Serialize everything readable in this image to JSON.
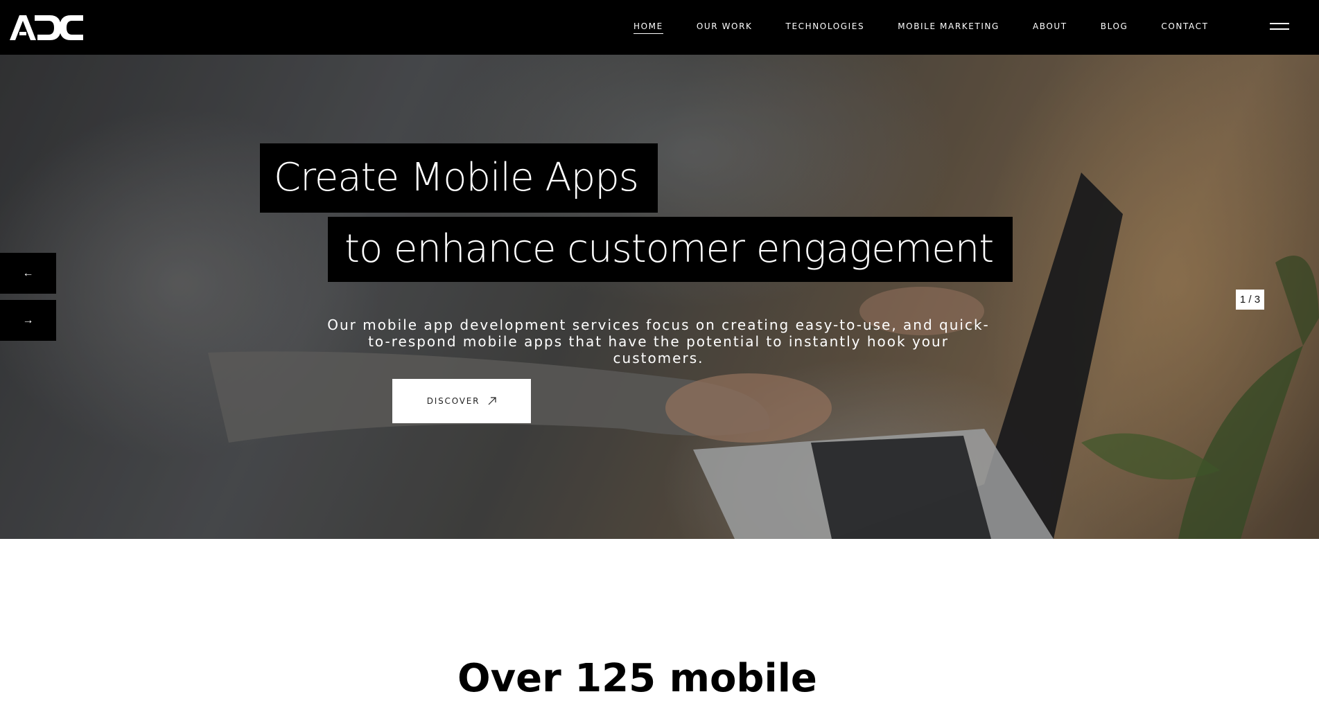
{
  "brand": {
    "logo_text": "ADC"
  },
  "nav": {
    "items": [
      {
        "label": "HOME",
        "active": true
      },
      {
        "label": "OUR WORK"
      },
      {
        "label": "TECHNOLOGIES"
      },
      {
        "label": "MOBILE MARKETING"
      },
      {
        "label": "ABOUT"
      },
      {
        "label": "BLOG"
      },
      {
        "label": "CONTACT"
      }
    ],
    "menu_icon": "hamburger-icon"
  },
  "hero": {
    "headline_line1": "Create Mobile Apps",
    "headline_line2": "to enhance customer engagement",
    "subtitle": "Our mobile app development services focus on creating easy-to-use, and quick-to-respond mobile apps that have the potential to instantly hook your customers.",
    "cta_label": "DISCOVER",
    "cta_icon": "arrow-up-right-icon",
    "prev_label": "←",
    "next_label": "→",
    "slide_counter": "1 / 3"
  },
  "section": {
    "heading_partial": "Over 125 mobile"
  },
  "colors": {
    "nav_bg": "#000000",
    "nav_text": "#ffffff",
    "cta_bg": "#ffffff",
    "headline_bg": "#000000"
  }
}
